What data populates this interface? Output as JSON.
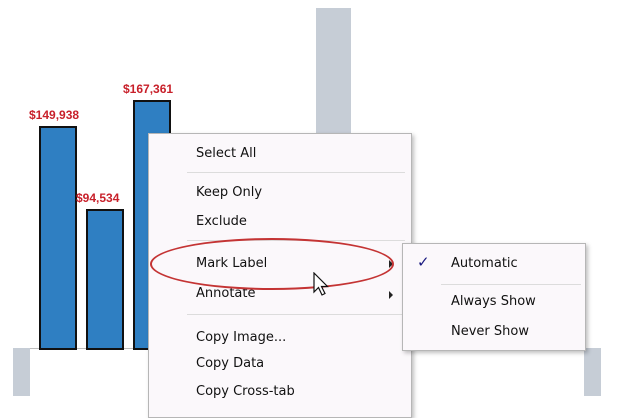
{
  "chart_data": {
    "type": "bar",
    "values": [
      149938,
      94534,
      167361
    ],
    "labels": [
      "$149,938",
      "$94,534",
      "$167,361"
    ]
  },
  "context_menu": {
    "items": [
      "Select All",
      "Keep Only",
      "Exclude",
      "Mark Label",
      "Annotate",
      "Copy Image...",
      "Copy Data",
      "Copy Cross-tab"
    ]
  },
  "submenu": {
    "items": [
      "Automatic",
      "Always Show",
      "Never Show"
    ],
    "selected": "Automatic"
  },
  "colors": {
    "bar_fill": "#2f7fc2",
    "label_red": "#c8202a",
    "highlight_oval": "#c43434",
    "menu_bg": "#fbf8fb"
  },
  "icons": [
    "pointer-cursor-icon",
    "checkmark-icon",
    "submenu-arrow-icon"
  ]
}
